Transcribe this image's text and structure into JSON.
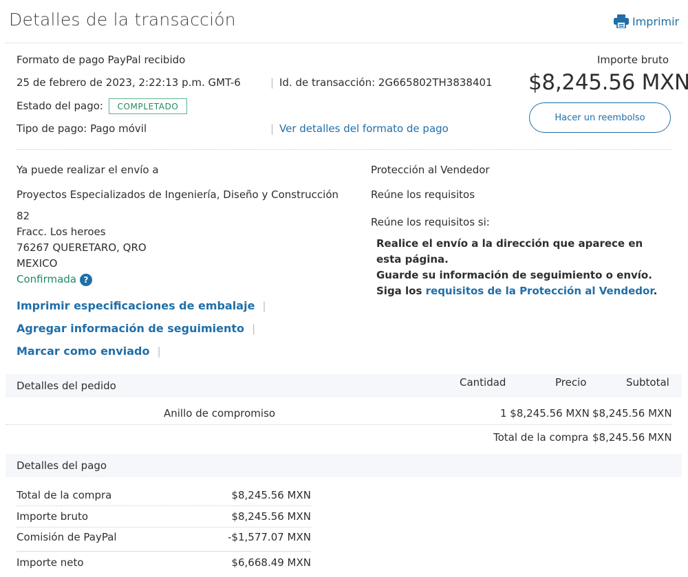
{
  "header": {
    "title": "Detalles de la transacción",
    "print_label": "Imprimir"
  },
  "summary": {
    "format_received": "Formato de pago PayPal recibido",
    "date": "25 de febrero de 2023, 2:22:13 p.m. GMT-6",
    "transaction_id": "Id. de transacción: 2G665802TH3838401",
    "status_label": "Estado del pago:",
    "status_badge": "COMPLETADO",
    "payment_type": "Tipo de pago: Pago móvil",
    "view_format_link": "Ver detalles del formato de pago",
    "gross_label": "Importe bruto",
    "gross_amount": "$8,245.56 MXN",
    "refund_button": "Hacer un reembolso",
    "separator": "|"
  },
  "shipping": {
    "heading": "Ya puede realizar el envío a",
    "name": "Proyectos Especializados de Ingeniería, Diseño y Construcción",
    "line1": "82",
    "line2": "Fracc. Los heroes",
    "line3": "76267 QUERETARO, QRO",
    "line4": "MEXICO",
    "confirmed": "Confirmada",
    "help_glyph": "?",
    "links": [
      "Imprimir especificaciones de embalaje",
      "Agregar información de seguimiento",
      "Marcar como enviado"
    ]
  },
  "protection": {
    "heading": "Protección al Vendedor",
    "eligibility": "Reúne los requisitos",
    "conditions_label": "Reúne los requisitos si:",
    "req1_line1": "Realice el envío a la dirección que aparece en",
    "req1_line2": "esta página.",
    "req2": "Guarde su información de seguimiento o envío.",
    "req3_prefix": "Siga los ",
    "req3_link": "requisitos de la Protección al Vendedor",
    "req3_suffix": "."
  },
  "order": {
    "heading": "Detalles del pedido",
    "col_quantity": "Cantidad",
    "col_price": "Precio",
    "col_subtotal": "Subtotal",
    "item_name": "Anillo de compromiso",
    "item_qty_price": "1 $8,245.56 MXN",
    "item_subtotal": "$8,245.56 MXN",
    "total_label": "Total de la compra",
    "total_value": "$8,245.56 MXN"
  },
  "payment": {
    "heading": "Detalles del pago",
    "rows": [
      {
        "label": "Total de la compra",
        "value": "$8,245.56 MXN"
      },
      {
        "label": "Importe bruto",
        "value": "$8,245.56 MXN"
      },
      {
        "label": "Comisión de PayPal",
        "value": "-$1,577.07 MXN"
      },
      {
        "label": "Importe neto",
        "value": "$6,668.49 MXN"
      }
    ]
  },
  "icons": {
    "print": "printer-icon",
    "help": "help-icon"
  },
  "colors": {
    "link": "#1f6ea8",
    "badge_border": "#58b58e",
    "badge_text": "#1e8a60",
    "band": "#f5f7fa"
  }
}
